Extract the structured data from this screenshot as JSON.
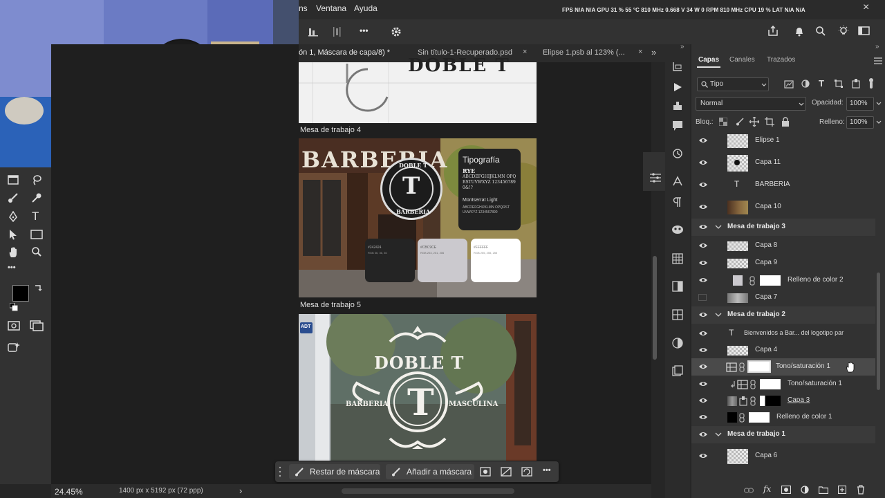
{
  "menubar": {
    "items": [
      "ns",
      "Ventana",
      "Ayuda"
    ],
    "perf": "FPS N/A N/A   GPU 31 % 55 °C 810 MHz 0.668 V 34 W 0 RPM 810 MHz   CPU 19 %   LAT N/A N/A"
  },
  "tabs": [
    {
      "label": "ón 1, Máscara de capa/8) *",
      "active": true
    },
    {
      "label": "Sin título-1-Recuperado.psd"
    },
    {
      "label": "Elipse 1.psb al 123% (..."
    }
  ],
  "tab_close": "×",
  "tab_overflow": "»",
  "canvas": {
    "artboard4": "Mesa de trabajo 4",
    "artboard5": "Mesa de trabajo 5",
    "top_sign": "DOBLE T",
    "barberia_wall": "BARBERIA",
    "badge_top": "DOBLE T",
    "badge_letter": "T",
    "badge_bottom": "BARBERIA",
    "typo_title": "Tipografía",
    "typo_font1": "RYE",
    "typo_sample1": "ABCDEFGHIJKLMN OPQRSTUVWXYZ 1234567890&!?",
    "typo_font2": "Montserrat Light",
    "typo_sample2": "ABCDEFGHIJKLMN OPQRSTUVWXYZ 1234567890",
    "swatch1_hex": "#242424",
    "swatch1_rgb": "RGB 36, 36, 36",
    "swatch2_hex": "#CBC9CE",
    "swatch2_rgb": "RGB 203, 201, 206",
    "swatch3_hex": "#FFFFFF",
    "swatch3_rgb": "RGB 255, 255, 255",
    "window_title": "DOBLE T",
    "window_letter": "T",
    "window_left": "BARBERIA",
    "window_right": "MASCULINA",
    "sticker": "ADT"
  },
  "floatbar": {
    "restar": "Restar de máscara",
    "anadir": "Añadir a máscara",
    "more": "•••"
  },
  "status": {
    "zoom": "24.45%",
    "size": "1400 px x 5192 px (72 ppp)",
    "arrow": "›"
  },
  "panel": {
    "tabs": [
      "Capas",
      "Canales",
      "Trazados"
    ],
    "filter": "Tipo",
    "blend": "Normal",
    "opacity_label": "Opacidad:",
    "opacity": "100%",
    "lock_label": "Bloq.:",
    "fill_label": "Relleno:",
    "fill": "100%",
    "layers": [
      {
        "name": "Elipse 1",
        "type": "thumb"
      },
      {
        "name": "Capa 11",
        "type": "thumb"
      },
      {
        "name": "BARBERIA",
        "type": "text"
      },
      {
        "name": "Capa 10",
        "type": "photo"
      },
      {
        "name": "Mesa de trabajo 3",
        "type": "group"
      },
      {
        "name": "Capa 8",
        "type": "thumb"
      },
      {
        "name": "Capa 9",
        "type": "thumb"
      },
      {
        "name": "Relleno de color 2",
        "type": "fill"
      },
      {
        "name": "Capa 7",
        "type": "thumb"
      },
      {
        "name": "Mesa de trabajo 2",
        "type": "group"
      },
      {
        "name": "Bienvenidos a Bar... del logotipo par",
        "type": "text"
      },
      {
        "name": "Capa 4",
        "type": "thumb"
      },
      {
        "name": "Tono/saturación 1",
        "type": "adjust"
      },
      {
        "name": "Tono/saturación 1",
        "type": "adjust-clip"
      },
      {
        "name": "Capa 3",
        "type": "masked"
      },
      {
        "name": "Relleno de color 1",
        "type": "fill-black"
      },
      {
        "name": "Mesa de trabajo 1",
        "type": "group"
      },
      {
        "name": "Capa 6",
        "type": "thumb"
      }
    ]
  },
  "icons": {
    "text_tool": "T",
    "menu_more": "•••",
    "close": "×"
  }
}
